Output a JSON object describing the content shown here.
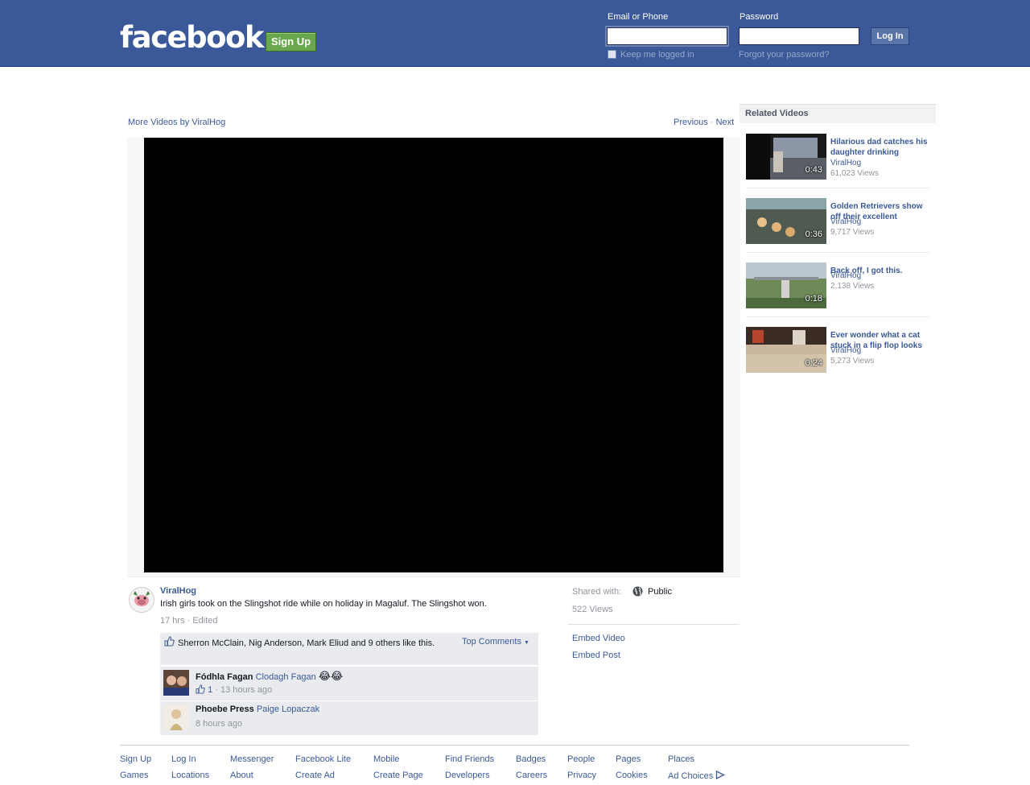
{
  "header": {
    "logo": "facebook",
    "signup_label": "Sign Up",
    "email_label": "Email or Phone",
    "password_label": "Password",
    "login_label": "Log In",
    "keep_logged_in": "Keep me logged in",
    "forgot_password": "Forgot your password?",
    "colors": {
      "bar": "#3b5998",
      "signup": "#69a74e"
    }
  },
  "video": {
    "more_videos": "More Videos by ViralHog",
    "previous": "Previous",
    "separator": "·",
    "next": "Next"
  },
  "sidebar": {
    "title": "Related Videos",
    "items": [
      {
        "title": "Hilarious dad catches his daughter drinking",
        "author": "ViralHog",
        "views": "61,023 Views",
        "duration": "0:43"
      },
      {
        "title": "Golden Retrievers show off their excellent",
        "author": "ViralHog",
        "views": "9,717 Views",
        "duration": "0:36"
      },
      {
        "title": "Back off, I got this.",
        "author": "ViralHog",
        "views": "2,138 Views",
        "duration": "0:18"
      },
      {
        "title": "Ever wonder what a cat stuck in a flip flop looks",
        "author": "ViralHog",
        "views": "5,273 Views",
        "duration": "0:24"
      }
    ]
  },
  "post": {
    "author": "ViralHog",
    "text": "Irish girls took on the Slingshot ride while on holiday in Magaluf. The Slingshot won.",
    "meta": "17 hrs · Edited",
    "likes_text": "Sherron McClain, Nig Anderson, Mark Eliud and 9 others like this.",
    "top_comments": "Top Comments",
    "comments": [
      {
        "name": "Fódhla Fagan",
        "tag": "Clodagh Fagan",
        "emoji": "😂😂",
        "like_count": "1",
        "time": "· 13 hours ago"
      },
      {
        "name": "Phoebe Press",
        "tag": "Paige Lopaczak",
        "time": "8 hours ago"
      }
    ],
    "shared_with_label": "Shared with:",
    "shared_with_value": "Public",
    "views": "522 Views",
    "embed_video": "Embed Video",
    "embed_post": "Embed Post"
  },
  "footer": {
    "row1": [
      "Sign Up",
      "Log In",
      "Messenger",
      "Facebook Lite",
      "Mobile",
      "Find Friends",
      "Badges",
      "People",
      "Pages",
      "Places"
    ],
    "row2": [
      "Games",
      "Locations",
      "About",
      "Create Ad",
      "Create Page",
      "Developers",
      "Careers",
      "Privacy",
      "Cookies",
      "Ad Choices"
    ]
  }
}
